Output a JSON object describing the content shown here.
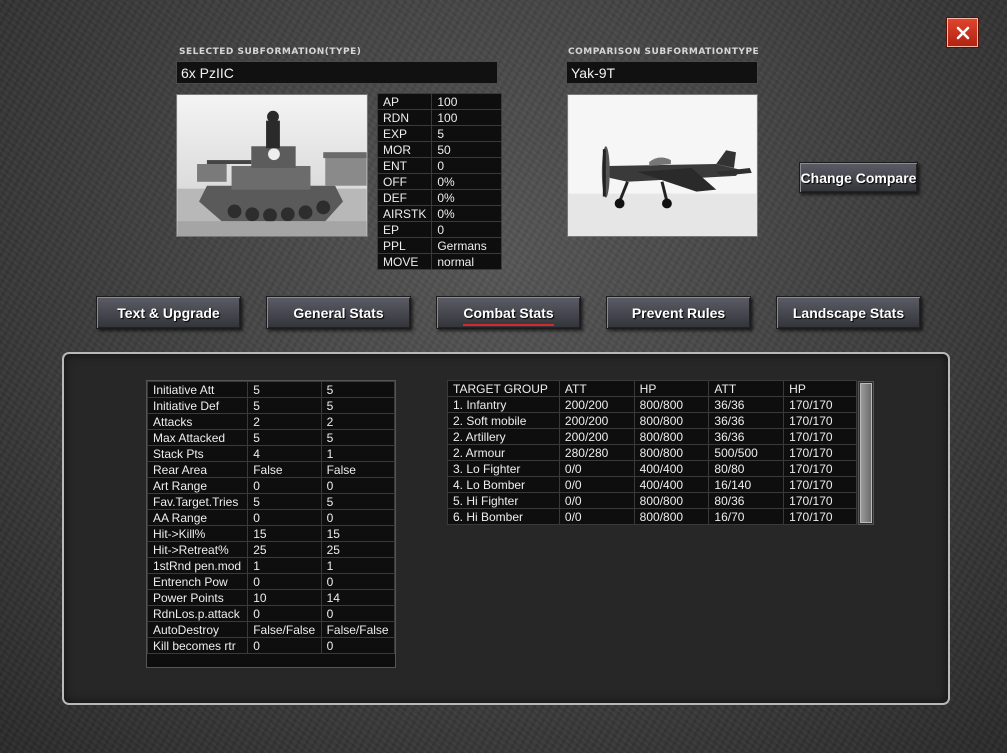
{
  "window": {
    "close_icon": "close-x-icon",
    "accent_color": "#c8301b"
  },
  "selected": {
    "label": "SELECTED SUBFORMATION(TYPE)",
    "name": "6x PzIIC",
    "stats": [
      {
        "key": "AP",
        "value": "100"
      },
      {
        "key": "RDN",
        "value": "100"
      },
      {
        "key": "EXP",
        "value": "5"
      },
      {
        "key": "MOR",
        "value": "50"
      },
      {
        "key": "ENT",
        "value": "0"
      },
      {
        "key": "OFF",
        "value": "0%"
      },
      {
        "key": "DEF",
        "value": "0%"
      },
      {
        "key": "AIRSTK",
        "value": "0%"
      },
      {
        "key": "EP",
        "value": "0"
      },
      {
        "key": "PPL",
        "value": "Germans"
      },
      {
        "key": "MOVE",
        "value": "normal"
      }
    ]
  },
  "comparison": {
    "label": "COMPARISON SUBFORMATIONTYPE",
    "name": "Yak-9T",
    "change_label": "Change Compare"
  },
  "tabs": [
    {
      "label": "Text & Upgrade",
      "active": false
    },
    {
      "label": "General Stats",
      "active": false
    },
    {
      "label": "Combat Stats",
      "active": true
    },
    {
      "label": "Prevent Rules",
      "active": false
    },
    {
      "label": "Landscape Stats",
      "active": false
    }
  ],
  "combat_stats": [
    {
      "name": "Initiative Att",
      "a": "5",
      "b": "5"
    },
    {
      "name": "Initiative Def",
      "a": "5",
      "b": "5"
    },
    {
      "name": "Attacks",
      "a": "2",
      "b": "2"
    },
    {
      "name": "Max Attacked",
      "a": "5",
      "b": "5"
    },
    {
      "name": "Stack Pts",
      "a": "4",
      "b": "1"
    },
    {
      "name": "Rear Area",
      "a": "False",
      "b": "False"
    },
    {
      "name": "Art Range",
      "a": "0",
      "b": "0"
    },
    {
      "name": "Fav.Target.Tries",
      "a": "5",
      "b": "5"
    },
    {
      "name": "AA Range",
      "a": "0",
      "b": "0"
    },
    {
      "name": "Hit->Kill%",
      "a": "15",
      "b": "15"
    },
    {
      "name": "Hit->Retreat%",
      "a": "25",
      "b": "25"
    },
    {
      "name": "1stRnd pen.mod",
      "a": "1",
      "b": "1"
    },
    {
      "name": "Entrench Pow",
      "a": "0",
      "b": "0"
    },
    {
      "name": "Power Points",
      "a": "10",
      "b": "14"
    },
    {
      "name": "RdnLos.p.attack",
      "a": "0",
      "b": "0"
    },
    {
      "name": "AutoDestroy",
      "a": "False/False",
      "b": "False/False"
    },
    {
      "name": "Kill becomes rtr",
      "a": "0",
      "b": "0"
    }
  ],
  "target_table": {
    "headers": [
      "TARGET GROUP",
      "ATT",
      "HP",
      "ATT",
      "HP"
    ],
    "rows": [
      [
        "1. Infantry",
        "200/200",
        "800/800",
        "36/36",
        "170/170"
      ],
      [
        "2. Soft mobile",
        "200/200",
        "800/800",
        "36/36",
        "170/170"
      ],
      [
        "2. Artillery",
        "200/200",
        "800/800",
        "36/36",
        "170/170"
      ],
      [
        "2. Armour",
        "280/280",
        "800/800",
        "500/500",
        "170/170"
      ],
      [
        "3. Lo Fighter",
        "0/0",
        "400/400",
        "80/80",
        "170/170"
      ],
      [
        "4. Lo Bomber",
        "0/0",
        "400/400",
        "16/140",
        "170/170"
      ],
      [
        "5. Hi Fighter",
        "0/0",
        "800/800",
        "80/36",
        "170/170"
      ],
      [
        "6. Hi Bomber",
        "0/0",
        "800/800",
        "16/70",
        "170/170"
      ]
    ]
  }
}
